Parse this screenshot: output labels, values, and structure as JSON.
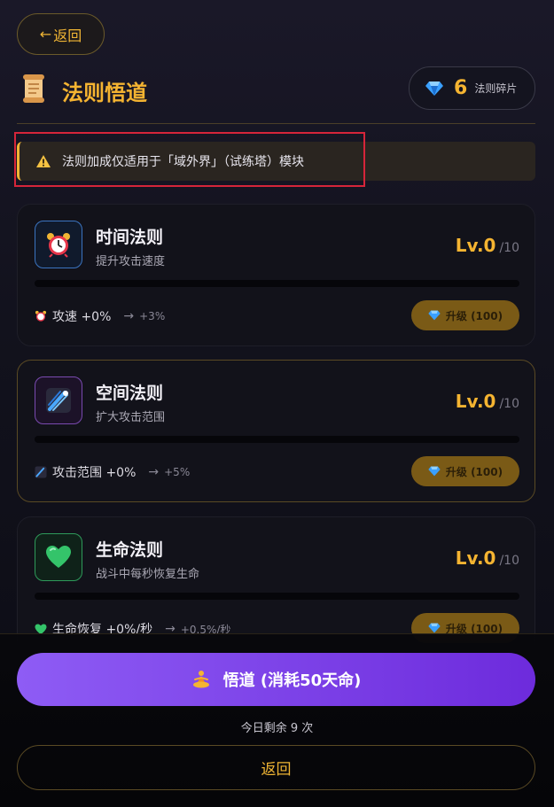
{
  "nav": {
    "back_arrow": "←",
    "back_label": "返回"
  },
  "header": {
    "icon": "scroll-icon",
    "title": "法则悟道"
  },
  "shards": {
    "icon": "gem-icon",
    "count": "6",
    "label": "法则碎片"
  },
  "notice": {
    "icon": "warning-icon",
    "text": "法则加成仅适用于「域外界」（试练塔）模块"
  },
  "laws": [
    {
      "icon": "alarm-clock-icon",
      "name": "时间法则",
      "desc": "提升攻击速度",
      "level": "Lv.0",
      "max": "/10",
      "progress": 0,
      "stat_label": "攻速 +0%",
      "stat_arrow": "→",
      "stat_next": "+3%",
      "upgrade_label": "升级 (100)"
    },
    {
      "icon": "comet-icon",
      "name": "空间法则",
      "desc": "扩大攻击范围",
      "level": "Lv.0",
      "max": "/10",
      "progress": 0,
      "stat_label": "攻击范围 +0%",
      "stat_arrow": "→",
      "stat_next": "+5%",
      "upgrade_label": "升级 (100)"
    },
    {
      "icon": "green-heart-icon",
      "name": "生命法则",
      "desc": "战斗中每秒恢复生命",
      "level": "Lv.0",
      "max": "/10",
      "progress": 0,
      "stat_label": "生命恢复 +0%/秒",
      "stat_arrow": "→",
      "stat_next": "+0.5%/秒",
      "upgrade_label": "升级 (100)"
    }
  ],
  "footer": {
    "meditate_icon": "meditation-icon",
    "meditate_label": "悟道 (消耗50天命)",
    "remaining_text": "今日剩余 9 次",
    "back_label": "返回"
  },
  "colors": {
    "accent": "#f5b431",
    "purple_start": "#8e5cf5",
    "purple_end": "#6d2bdc",
    "highlight_frame": "#d6253a"
  }
}
